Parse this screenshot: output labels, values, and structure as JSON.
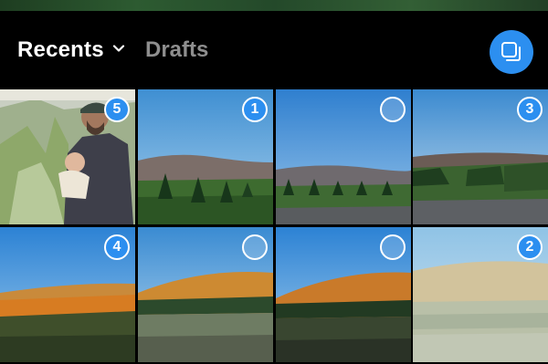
{
  "header": {
    "album_label": "Recents",
    "drafts_label": "Drafts",
    "multi_select_icon": "multi-select-icon",
    "accent_color": "#2C8FF0"
  },
  "grid": {
    "tiles": [
      {
        "scene": "person-with-baby",
        "selection_number": "5",
        "selected": true
      },
      {
        "scene": "hills-evergreens",
        "selection_number": "1",
        "selected": true
      },
      {
        "scene": "hills-evergreens-blue",
        "selection_number": "",
        "selected": false
      },
      {
        "scene": "tree-farm-road",
        "selection_number": "3",
        "selected": true
      },
      {
        "scene": "autumn-hill",
        "selection_number": "4",
        "selected": true
      },
      {
        "scene": "autumn-hill-field",
        "selection_number": "",
        "selected": false
      },
      {
        "scene": "autumn-hill-dark",
        "selection_number": "",
        "selected": false
      },
      {
        "scene": "hazy-field",
        "selection_number": "2",
        "selected": true
      }
    ]
  }
}
